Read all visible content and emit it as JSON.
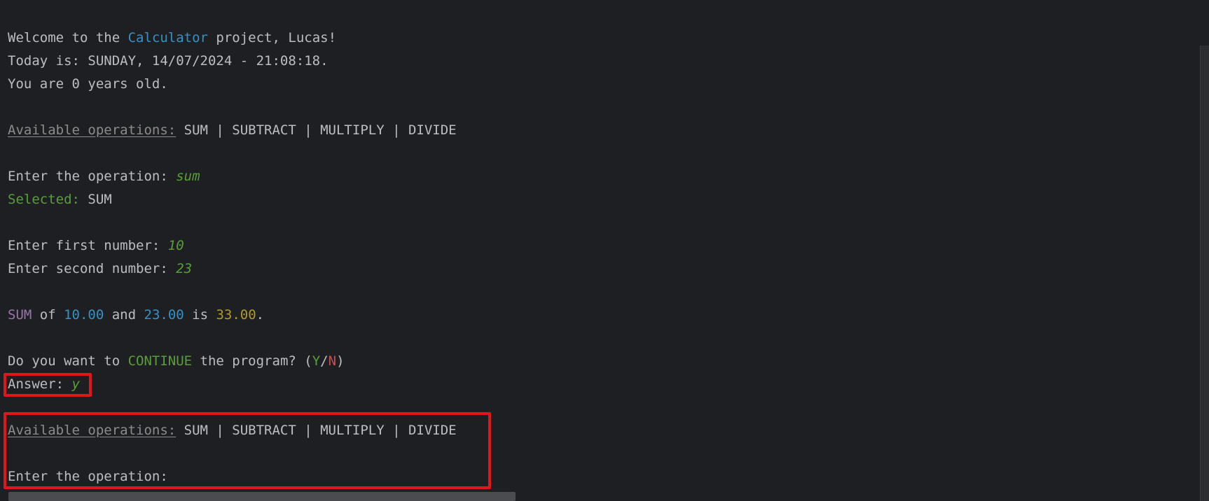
{
  "welcome": {
    "prefix": "Welcome to the ",
    "project": "Calculator",
    "suffix": " project, Lucas!"
  },
  "today_line": "Today is: SUNDAY, 14/07/2024 - 21:08:18.",
  "age_line": "You are 0 years old.",
  "operations_block_1": {
    "label": "Available operations:",
    "list": " SUM | SUBTRACT | MULTIPLY | DIVIDE"
  },
  "operation_prompt_1": {
    "prompt": "Enter the operation: ",
    "input": "sum"
  },
  "selected": {
    "label": "Selected:",
    "value": " SUM"
  },
  "first_number": {
    "prompt": "Enter first number: ",
    "input": "10"
  },
  "second_number": {
    "prompt": "Enter second number: ",
    "input": "23"
  },
  "result": {
    "op": "SUM",
    "of": " of ",
    "a": "10.00",
    "and": " and ",
    "b": "23.00",
    "is": " is ",
    "result": "33.00",
    "end": "."
  },
  "continue_prompt": {
    "prefix": "Do you want to ",
    "word": "CONTINUE",
    "middle": " the program? (",
    "yes": "Y",
    "slash": "/",
    "no": "N",
    "close": ")"
  },
  "answer": {
    "prompt": "Answer: ",
    "input": "y"
  },
  "operations_block_2": {
    "label": "Available operations:",
    "list": " SUM | SUBTRACT | MULTIPLY | DIVIDE"
  },
  "operation_prompt_2": {
    "prompt": "Enter the operation:"
  },
  "colors": {
    "background": "#1e1f22",
    "text": "#bcbec4",
    "blue": "#3592c4",
    "green": "#5a9e3a",
    "purple": "#9876aa",
    "gold": "#b09a2a",
    "red": "#c94f4f",
    "highlight": "#e0161c"
  }
}
